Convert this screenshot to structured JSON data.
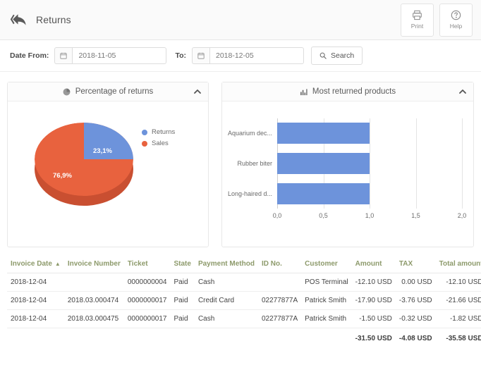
{
  "header": {
    "back_icon": "back-arrow-icon",
    "title": "Returns",
    "buttons": [
      {
        "label": "Print",
        "icon": "printer-icon"
      },
      {
        "label": "Help",
        "icon": "question-circle-icon"
      }
    ]
  },
  "filters": {
    "date_from_label": "Date From:",
    "date_from_value": "2018-11-05",
    "date_from_placeholder": "2018-11-05",
    "to_label": "To:",
    "date_to_value": "2018-12-05",
    "date_to_placeholder": "2018-12-05",
    "search_label": "Search",
    "search_icon": "search-icon",
    "calendar_icon": "calendar-icon"
  },
  "panels": {
    "pie": {
      "title": "Percentage of returns",
      "icon": "pie-chart-icon",
      "collapse_icon": "chevron-up-icon"
    },
    "bar": {
      "title": "Most returned products",
      "icon": "bar-chart-icon",
      "collapse_icon": "chevron-up-icon"
    }
  },
  "chart_data": [
    {
      "type": "pie",
      "title": "Percentage of returns",
      "labels": [
        "Returns",
        "Sales"
      ],
      "values": [
        23.1,
        76.9
      ],
      "value_labels": [
        "23,1%",
        "76,9%"
      ],
      "colors": [
        "#6d93db",
        "#e8623e"
      ],
      "legend_position": "right"
    },
    {
      "type": "bar",
      "orientation": "horizontal",
      "title": "Most returned products",
      "categories": [
        "Aquarium dec...",
        "Rubber biter",
        "Long-haired d..."
      ],
      "values": [
        1.0,
        1.0,
        1.0
      ],
      "xlabel": "",
      "ylabel": "",
      "xlim": [
        0,
        2.0
      ],
      "xticks": [
        "0,0",
        "0,5",
        "1,0",
        "1,5",
        "2,0"
      ],
      "xtick_values": [
        0,
        0.5,
        1.0,
        1.5,
        2.0
      ],
      "grid": true,
      "color": "#6d93db",
      "legend_position": "none"
    }
  ],
  "table": {
    "columns": [
      "Invoice Date",
      "Invoice Number",
      "Ticket",
      "State",
      "Payment Method",
      "ID No.",
      "Customer",
      "Amount",
      "TAX",
      "Total amount"
    ],
    "sort_column": "Invoice Date",
    "sort_caret": "▲",
    "rows": [
      {
        "invoice_date": "2018-12-04",
        "invoice_number": "",
        "ticket": "0000000004",
        "state": "Paid",
        "payment_method": "Cash",
        "id_no": "",
        "customer": "POS Terminal",
        "amount": "-12.10 USD",
        "tax": "0.00 USD",
        "total": "-12.10 USD"
      },
      {
        "invoice_date": "2018-12-04",
        "invoice_number": "2018.03.000474",
        "ticket": "0000000017",
        "state": "Paid",
        "payment_method": "Credit Card",
        "id_no": "02277877A",
        "customer": "Patrick Smith",
        "amount": "-17.90 USD",
        "tax": "-3.76 USD",
        "total": "-21.66 USD"
      },
      {
        "invoice_date": "2018-12-04",
        "invoice_number": "2018.03.000475",
        "ticket": "0000000017",
        "state": "Paid",
        "payment_method": "Cash",
        "id_no": "02277877A",
        "customer": "Patrick Smith",
        "amount": "-1.50 USD",
        "tax": "-0.32 USD",
        "total": "-1.82 USD"
      }
    ],
    "totals": {
      "amount": "-31.50 USD",
      "tax": "-4.08 USD",
      "total": "-35.58 USD"
    }
  },
  "colors": {
    "accent_blue": "#6d93db",
    "accent_orange": "#e8623e",
    "link_green": "#9aa86f",
    "header_green": "#8d9a6b"
  }
}
